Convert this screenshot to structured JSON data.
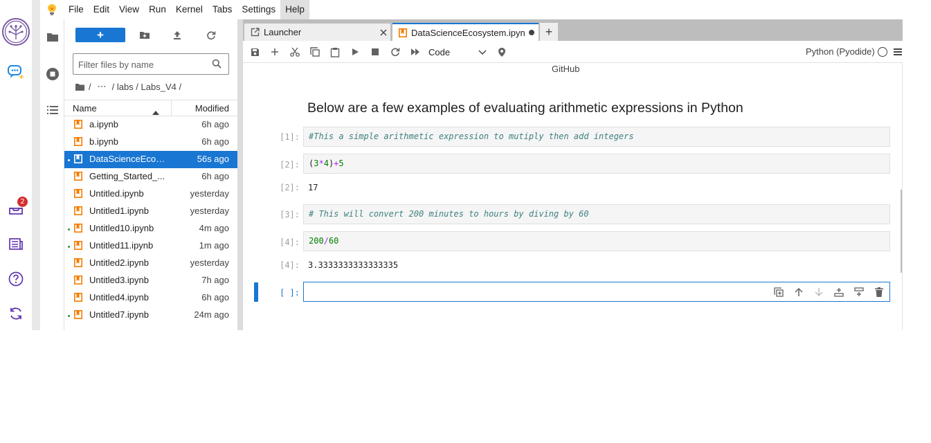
{
  "menu": {
    "items": [
      "File",
      "Edit",
      "View",
      "Run",
      "Kernel",
      "Tabs",
      "Settings",
      "Help"
    ],
    "active": "Help"
  },
  "rail": {
    "notification_count": "2"
  },
  "filebrowser": {
    "new_label": "+",
    "filter_placeholder": "Filter files by name",
    "breadcrumbs": [
      "/",
      "⋯",
      "/ labs / Labs_V4 /"
    ],
    "columns": {
      "name": "Name",
      "modified": "Modified"
    },
    "files": [
      {
        "name": "a.ipynb",
        "modified": "6h ago",
        "running": false,
        "selected": false
      },
      {
        "name": "b.ipynb",
        "modified": "6h ago",
        "running": false,
        "selected": false
      },
      {
        "name": "DataScienceEcosy...",
        "modified": "56s ago",
        "running": true,
        "selected": true
      },
      {
        "name": "Getting_Started_...",
        "modified": "6h ago",
        "running": false,
        "selected": false
      },
      {
        "name": "Untitled.ipynb",
        "modified": "yesterday",
        "running": false,
        "selected": false
      },
      {
        "name": "Untitled1.ipynb",
        "modified": "yesterday",
        "running": false,
        "selected": false
      },
      {
        "name": "Untitled10.ipynb",
        "modified": "4m ago",
        "running": true,
        "selected": false
      },
      {
        "name": "Untitled11.ipynb",
        "modified": "1m ago",
        "running": true,
        "selected": false
      },
      {
        "name": "Untitled2.ipynb",
        "modified": "yesterday",
        "running": false,
        "selected": false
      },
      {
        "name": "Untitled3.ipynb",
        "modified": "7h ago",
        "running": false,
        "selected": false
      },
      {
        "name": "Untitled4.ipynb",
        "modified": "6h ago",
        "running": false,
        "selected": false
      },
      {
        "name": "Untitled7.ipynb",
        "modified": "24m ago",
        "running": true,
        "selected": false
      }
    ]
  },
  "tabs": {
    "launcher": "Launcher",
    "notebook": "DataScienceEcosystem.ipynb",
    "add_label": "+"
  },
  "toolbar": {
    "cell_type": "Code",
    "kernel": "Python (Pyodide)"
  },
  "notebook": {
    "top_text": "GitHub",
    "heading": "Below are a few examples of evaluating arithmetic expressions in Python",
    "cells": {
      "c1": {
        "prompt": "[1]:",
        "code": "#This a simple arithmetic expression to mutiply then add integers"
      },
      "c2": {
        "prompt": "[2]:",
        "code_parts": [
          "(",
          "3",
          "*",
          "4",
          ")",
          "+",
          "5"
        ],
        "out_prompt": "[2]:",
        "output": "17"
      },
      "c3": {
        "prompt": "[3]:",
        "code": "# This will convert 200 minutes to hours by diving by 60"
      },
      "c4": {
        "prompt": "[4]:",
        "code_parts": [
          "200",
          "/",
          "60"
        ],
        "out_prompt": "[4]:",
        "output": "3.3333333333333335"
      },
      "c5": {
        "prompt": "[ ]:"
      }
    }
  },
  "colors": {
    "accent": "#1976d2",
    "running_dot": "#388e3c",
    "notebook_icon": "#f57c00",
    "badge": "#d32f2f"
  }
}
